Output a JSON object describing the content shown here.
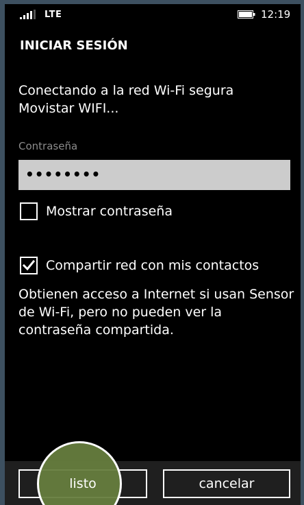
{
  "status_bar": {
    "network": "LTE",
    "time": "12:19",
    "signal_icon": "signal-strength-icon",
    "battery_icon": "battery-icon"
  },
  "dialog": {
    "title": "INICIAR SESIÓN",
    "message": "Conectando a la red Wi-Fi segura Movistar WIFI...",
    "password": {
      "label": "Contraseña",
      "value": "••••••••"
    },
    "show_password": {
      "label": "Mostrar contraseña",
      "checked": false
    },
    "share_network": {
      "label": "Compartir red con mis contactos",
      "checked": true
    },
    "description": "Obtienen acceso a Internet si usan Sensor de Wi-Fi, pero no pueden ver la contraseña compartida."
  },
  "app_bar": {
    "done_label": "listo",
    "cancel_label": "cancelar"
  },
  "colors": {
    "background": "#000000",
    "text": "#ffffff",
    "label_gray": "#8c8c8c",
    "input_background": "#cccccc",
    "tap_highlight": "#667d3e"
  }
}
